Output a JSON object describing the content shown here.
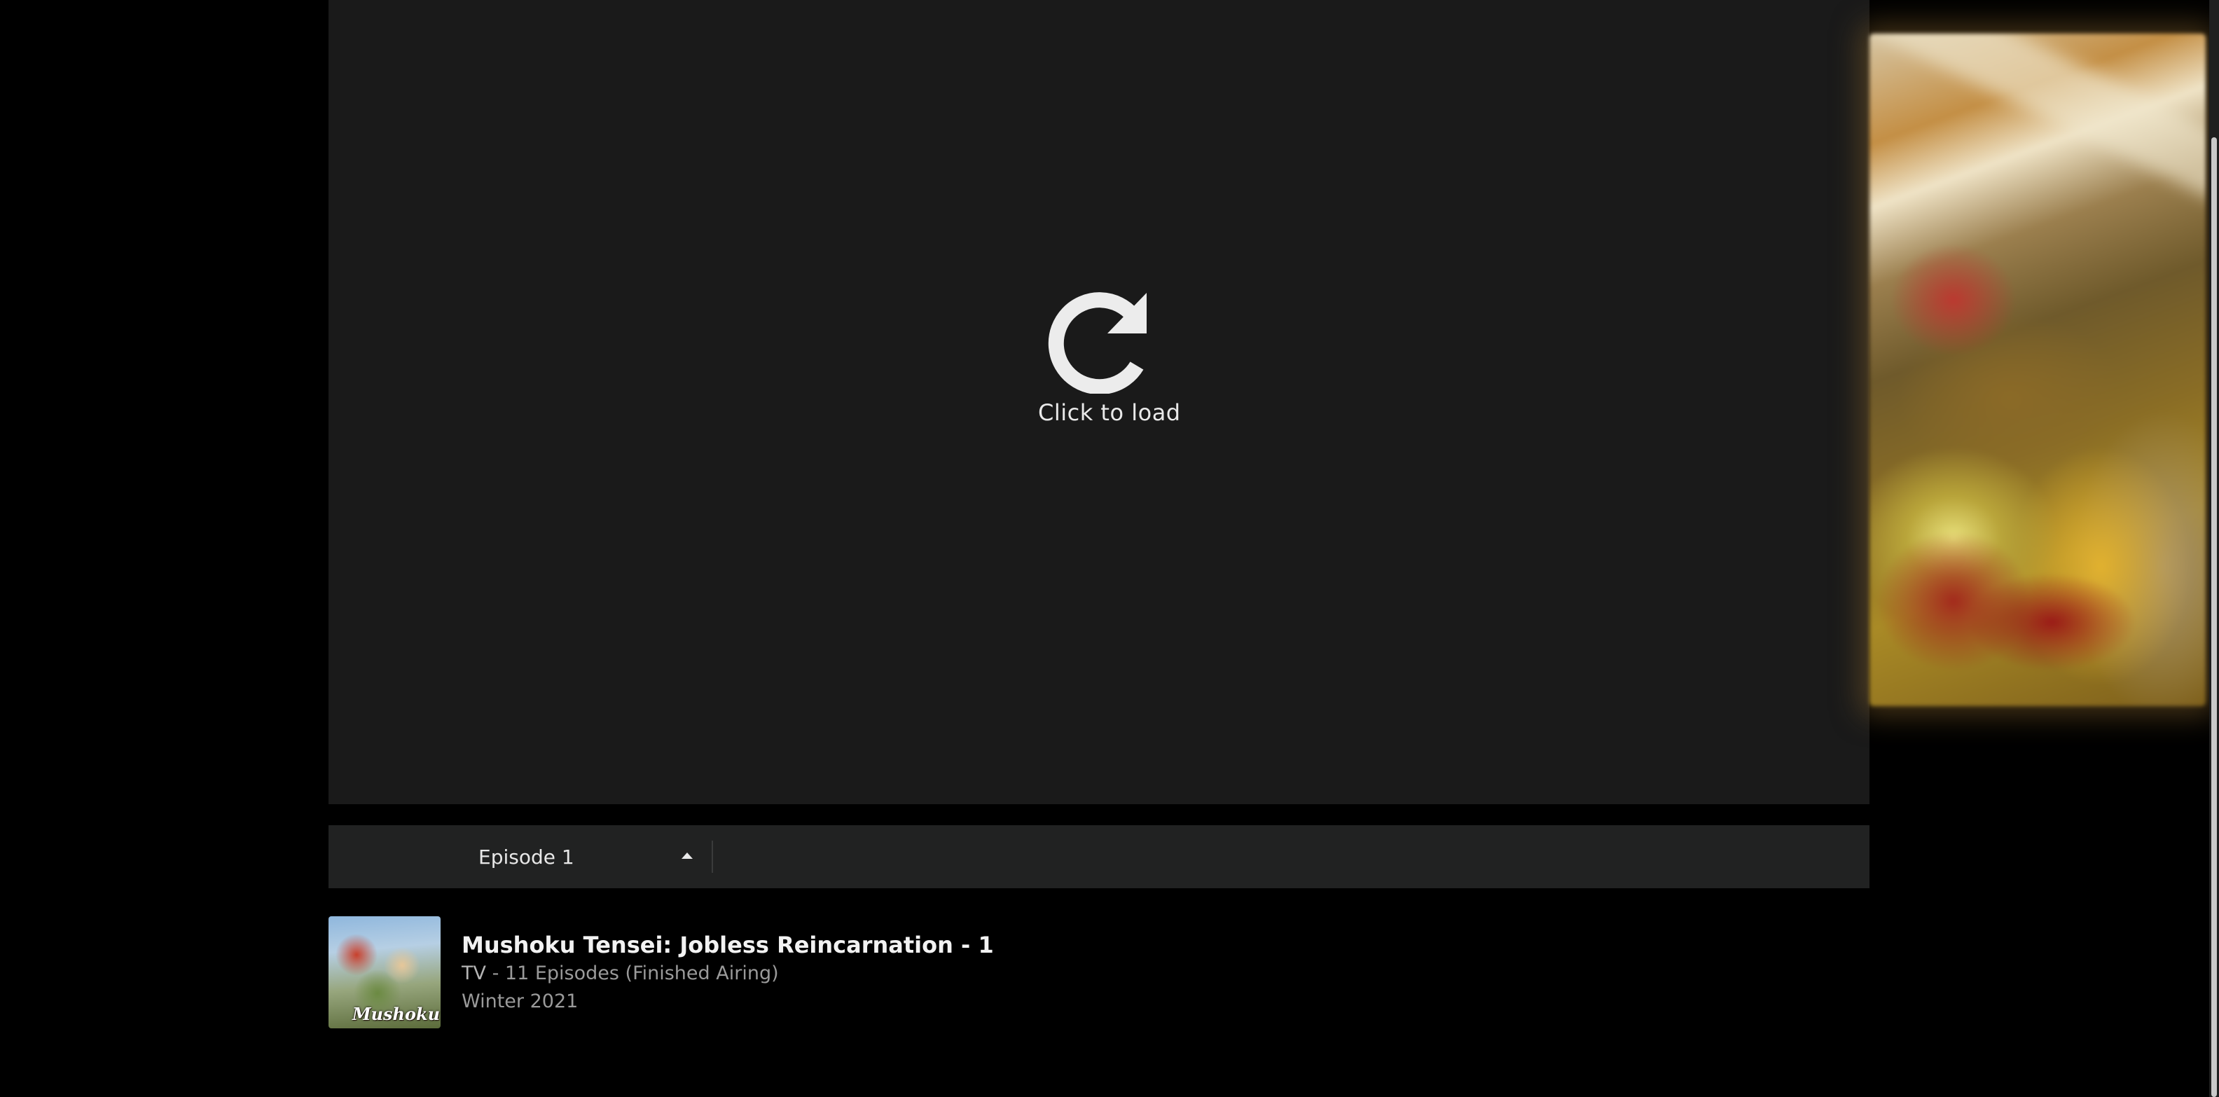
{
  "player": {
    "load_label": "Click to load",
    "reload_icon": "reload-icon"
  },
  "episode_selector": {
    "selected": "Episode 1",
    "icon": "caret-up-icon"
  },
  "anime": {
    "title": "Mushoku Tensei: Jobless Reincarnation - 1",
    "type": "TV",
    "separator": "-",
    "episodes": "11 Episodes (Finished Airing)",
    "season": "Winter 2021",
    "poster_text": "Mushoku"
  },
  "colors": {
    "background": "#000000",
    "player_bg": "#1a1a1a",
    "episode_bar_bg": "#212222",
    "title_text": "#f2f2f2",
    "meta_text": "#9a9a9a"
  }
}
